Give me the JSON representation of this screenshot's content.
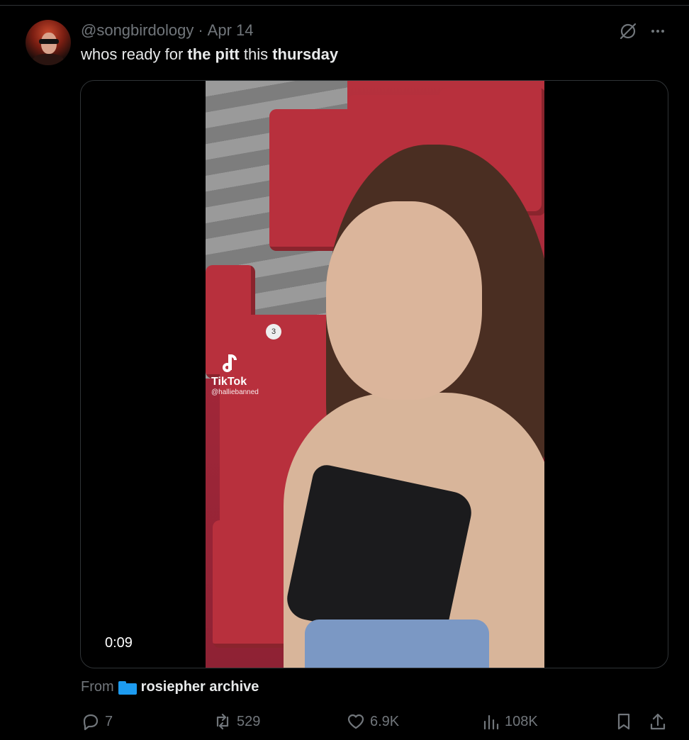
{
  "tweet": {
    "handle": "@songbirdology",
    "separator": "·",
    "date": "Apr 14",
    "text_parts": [
      "whos ready for ",
      "the pitt",
      " this ",
      "thursday"
    ]
  },
  "media": {
    "duration": "0:09",
    "watermark_brand": "TikTok",
    "watermark_user": "@halliebanned",
    "seat_number": "3"
  },
  "source": {
    "from_label": "From",
    "name": "rosiepher archive"
  },
  "actions": {
    "replies": "7",
    "reposts": "529",
    "likes": "6.9K",
    "views": "108K"
  },
  "colors": {
    "background": "#000000",
    "text": "#e7e9ea",
    "muted": "#71767b",
    "accent": "#1d9bf0",
    "border": "#2f3336"
  },
  "icons": {
    "reply": "reply-icon",
    "repost": "repost-icon",
    "like": "heart-icon",
    "views": "views-icon",
    "bookmark": "bookmark-icon",
    "share": "share-icon",
    "grok": "grok-icon",
    "more": "more-icon",
    "folder": "folder-icon"
  }
}
